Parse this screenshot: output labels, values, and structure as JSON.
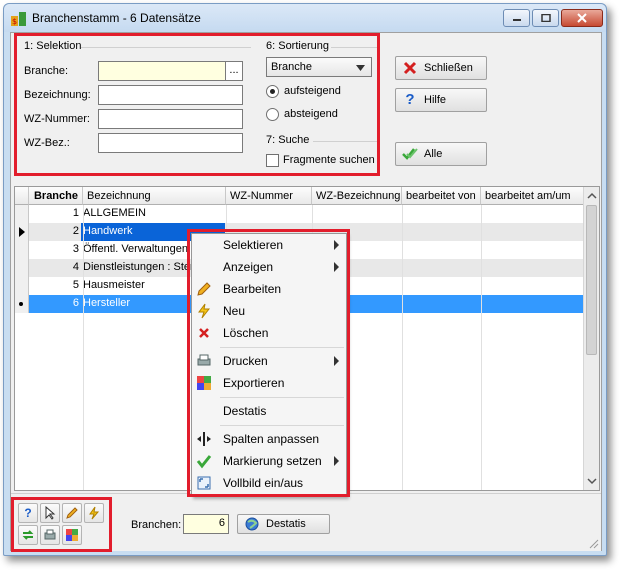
{
  "window": {
    "title": "Branchenstamm - 6 Datensätze"
  },
  "selektion": {
    "label": "1: Selektion",
    "fields": [
      {
        "label": "Branche:",
        "value": "",
        "browse": "..."
      },
      {
        "label": "Bezeichnung:",
        "value": ""
      },
      {
        "label": "WZ-Nummer:",
        "value": ""
      },
      {
        "label": "WZ-Bez.:",
        "value": ""
      }
    ]
  },
  "sortierung": {
    "label": "6: Sortierung",
    "selected": "Branche",
    "options": [
      "aufsteigend",
      "absteigend"
    ],
    "checked": "aufsteigend"
  },
  "suche": {
    "label": "7: Suche",
    "checkbox": "Fragmente suchen",
    "checked": false
  },
  "buttons": {
    "close": "Schließen",
    "help": "Hilfe",
    "all": "Alle"
  },
  "grid": {
    "columns": [
      "Branche",
      "Bezeichnung",
      "WZ-Nummer",
      "WZ-Bezeichnung",
      "bearbeitet von",
      "bearbeitet am/um"
    ],
    "rows": [
      {
        "nr": "1",
        "bez": "ALLGEMEIN"
      },
      {
        "nr": "2",
        "bez": "Handwerk"
      },
      {
        "nr": "3",
        "bez": "Öffentl. Verwaltungen"
      },
      {
        "nr": "4",
        "bez": "Dienstleistungen : Ster"
      },
      {
        "nr": "5",
        "bez": "Hausmeister"
      },
      {
        "nr": "6",
        "bez": "Hersteller"
      }
    ]
  },
  "context_menu": {
    "items": [
      {
        "label": "Selektieren",
        "icon": "none",
        "submenu": true
      },
      {
        "label": "Anzeigen",
        "icon": "none",
        "submenu": true
      },
      {
        "label": "Bearbeiten",
        "icon": "pencil-icon",
        "submenu": false
      },
      {
        "label": "Neu",
        "icon": "lightning-icon",
        "submenu": false
      },
      {
        "label": "Löschen",
        "icon": "delete-icon",
        "submenu": false
      },
      {
        "label": "Drucken",
        "icon": "printer-icon",
        "submenu": true
      },
      {
        "label": "Exportieren",
        "icon": "export-icon",
        "submenu": false
      },
      {
        "label": "Destatis",
        "icon": "none",
        "submenu": false
      },
      {
        "label": "Spalten anpassen",
        "icon": "column-resize-icon",
        "submenu": false
      },
      {
        "label": "Markierung setzen",
        "icon": "checkmark-icon",
        "submenu": true
      },
      {
        "label": "Vollbild ein/aus",
        "icon": "fullscreen-icon",
        "submenu": false
      }
    ]
  },
  "bottom": {
    "branchen_label": "Branchen:",
    "branchen_value": "6",
    "destatis_button": "Destatis"
  },
  "colors": {
    "highlight": "#e21d2c",
    "selection": "#3399ff"
  }
}
